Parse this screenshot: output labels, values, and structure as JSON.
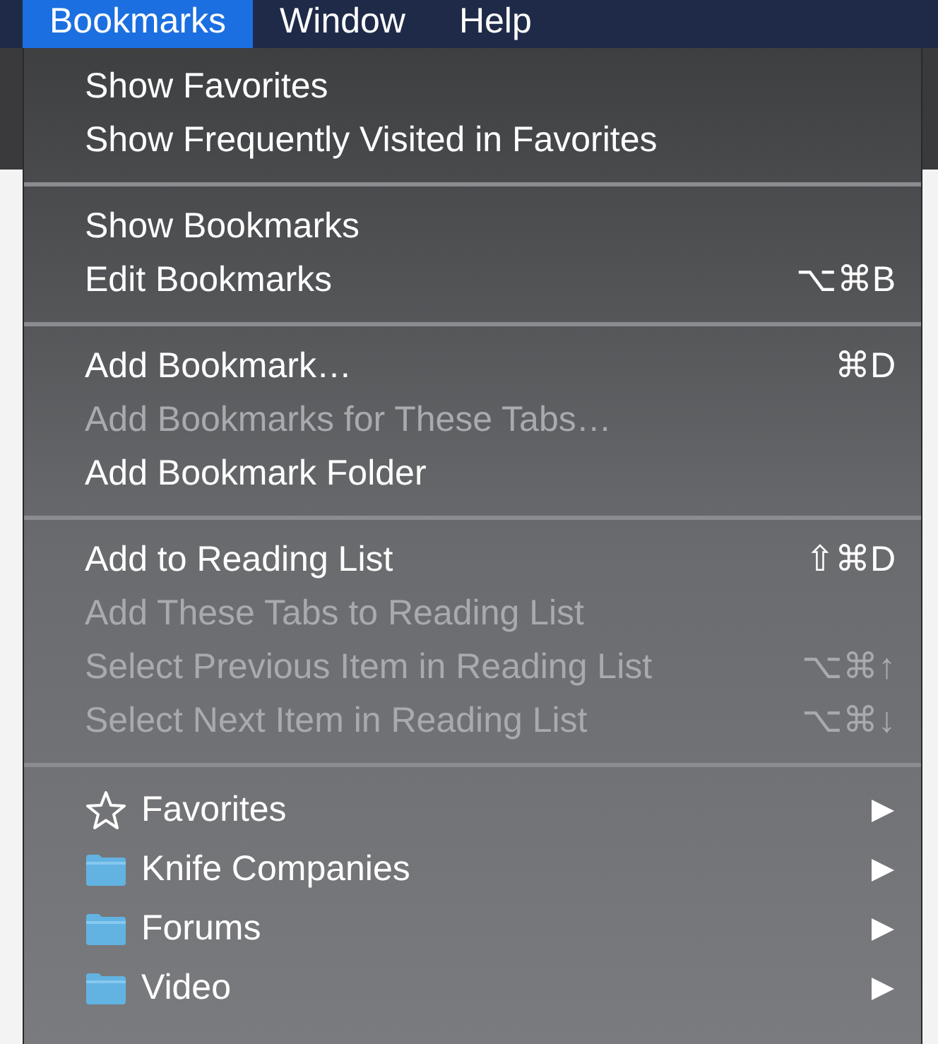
{
  "menubar": [
    {
      "label": "Bookmarks",
      "selected": true
    },
    {
      "label": "Window",
      "selected": false
    },
    {
      "label": "Help",
      "selected": false
    }
  ],
  "menu": {
    "sections": [
      {
        "items": [
          {
            "kind": "text",
            "label": "Show Favorites",
            "disabled": false
          },
          {
            "kind": "text",
            "label": "Show Frequently Visited in Favorites",
            "disabled": false
          }
        ]
      },
      {
        "items": [
          {
            "kind": "text",
            "label": "Show Bookmarks",
            "disabled": false
          },
          {
            "kind": "text",
            "label": "Edit Bookmarks",
            "shortcut": "⌥⌘B",
            "disabled": false
          }
        ]
      },
      {
        "items": [
          {
            "kind": "text",
            "label": "Add Bookmark…",
            "shortcut": "⌘D",
            "disabled": false
          },
          {
            "kind": "text",
            "label": "Add Bookmarks for These Tabs…",
            "disabled": true
          },
          {
            "kind": "text",
            "label": "Add Bookmark Folder",
            "disabled": false
          }
        ]
      },
      {
        "items": [
          {
            "kind": "text",
            "label": "Add to Reading List",
            "shortcut": "⇧⌘D",
            "disabled": false
          },
          {
            "kind": "text",
            "label": "Add These Tabs to Reading List",
            "disabled": true
          },
          {
            "kind": "text",
            "label": "Select Previous Item in Reading List",
            "shortcut": "⌥⌘↑",
            "disabled": true
          },
          {
            "kind": "text",
            "label": "Select Next Item in Reading List",
            "shortcut": "⌥⌘↓",
            "disabled": true
          }
        ]
      },
      {
        "items": [
          {
            "kind": "favorites",
            "label": "Favorites",
            "submenu": true,
            "disabled": false
          },
          {
            "kind": "folder",
            "label": "Knife Companies",
            "submenu": true,
            "disabled": false
          },
          {
            "kind": "folder",
            "label": "Forums",
            "submenu": true,
            "disabled": false
          },
          {
            "kind": "folder",
            "label": "Video",
            "submenu": true,
            "disabled": false
          }
        ]
      }
    ]
  }
}
